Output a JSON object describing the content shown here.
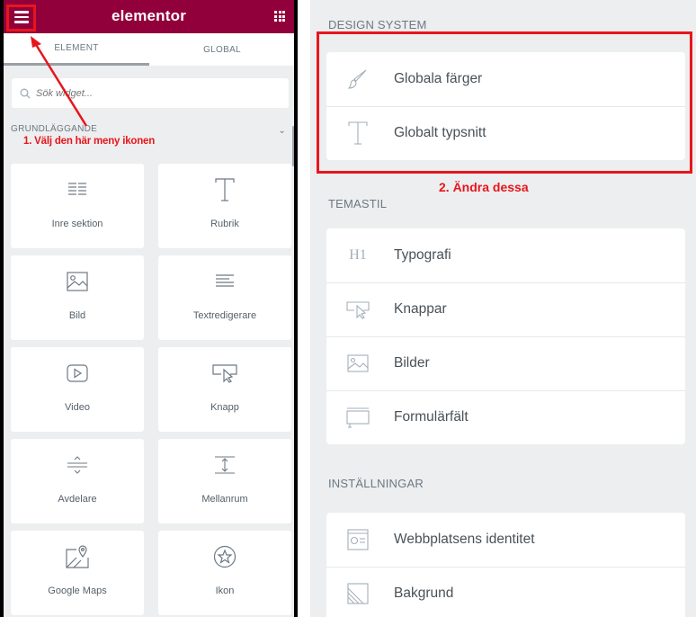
{
  "left": {
    "brand": "elementor",
    "tabs": {
      "element": "ELEMENT",
      "global": "GLOBAL"
    },
    "search_placeholder": "Sök widget...",
    "category": "GRUNDLÄGGANDE",
    "widgets": [
      {
        "label": "Inre sektion",
        "icon": "inner-section-icon"
      },
      {
        "label": "Rubrik",
        "icon": "heading-icon"
      },
      {
        "label": "Bild",
        "icon": "image-icon"
      },
      {
        "label": "Textredigerare",
        "icon": "text-editor-icon"
      },
      {
        "label": "Video",
        "icon": "video-icon"
      },
      {
        "label": "Knapp",
        "icon": "button-icon"
      },
      {
        "label": "Avdelare",
        "icon": "divider-icon"
      },
      {
        "label": "Mellanrum",
        "icon": "spacer-icon"
      },
      {
        "label": "Google Maps",
        "icon": "map-icon"
      },
      {
        "label": "Ikon",
        "icon": "star-icon"
      }
    ],
    "annotation": "1. Välj den här meny ikonen"
  },
  "right": {
    "design_system": {
      "title": "DESIGN SYSTEM",
      "items": [
        {
          "label": "Globala färger",
          "icon": "brush-icon"
        },
        {
          "label": "Globalt typsnitt",
          "icon": "typography-t-icon"
        }
      ]
    },
    "annotation": "2. Ändra dessa",
    "theme_style": {
      "title": "TEMASTIL",
      "items": [
        {
          "label": "Typografi",
          "icon": "h1-icon"
        },
        {
          "label": "Knappar",
          "icon": "button-cursor-icon"
        },
        {
          "label": "Bilder",
          "icon": "image-icon"
        },
        {
          "label": "Formulärfält",
          "icon": "form-field-icon"
        }
      ]
    },
    "settings": {
      "title": "INSTÄLLNINGAR",
      "items": [
        {
          "label": "Webbplatsens identitet",
          "icon": "site-identity-icon"
        },
        {
          "label": "Bakgrund",
          "icon": "background-icon"
        }
      ]
    }
  },
  "colors": {
    "brand": "#92003b",
    "annotation": "#e8151c"
  }
}
